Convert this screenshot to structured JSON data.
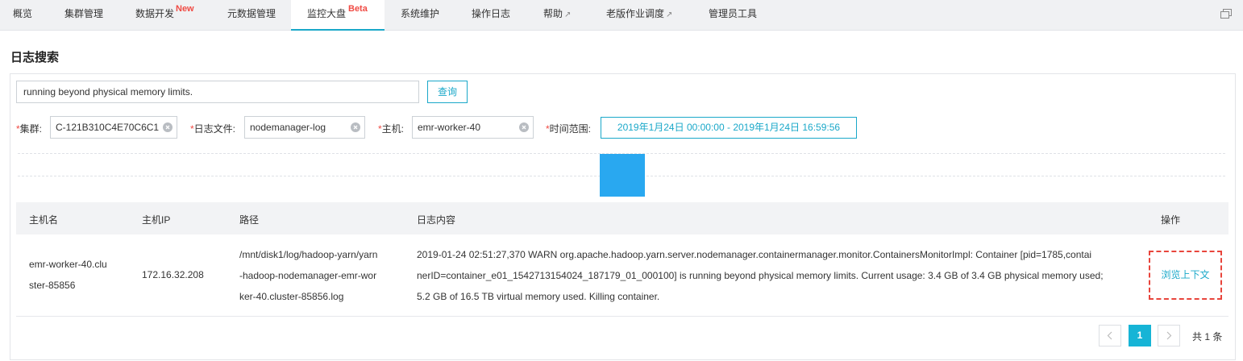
{
  "nav": {
    "tabs": [
      {
        "label": "概览"
      },
      {
        "label": "集群管理"
      },
      {
        "label": "数据开发",
        "badge": "New"
      },
      {
        "label": "元数据管理"
      },
      {
        "label": "监控大盘",
        "badge": "Beta",
        "active": true
      },
      {
        "label": "系统维护"
      },
      {
        "label": "操作日志"
      },
      {
        "label": "帮助",
        "external": true
      },
      {
        "label": "老版作业调度",
        "external": true
      },
      {
        "label": "管理员工具"
      }
    ]
  },
  "page": {
    "title": "日志搜索"
  },
  "search": {
    "value": "running beyond physical memory limits.",
    "button": "查询"
  },
  "filters": {
    "cluster": {
      "label": "集群:",
      "value": "C-121B310C4E70C6C1"
    },
    "logfile": {
      "label": "日志文件:",
      "value": "nodemanager-log"
    },
    "host": {
      "label": "主机:",
      "value": "emr-worker-40"
    },
    "time": {
      "label": "时间范围:",
      "value": "2019年1月24日 00:00:00 - 2019年1月24日 16:59:56"
    }
  },
  "table": {
    "columns": [
      "主机名",
      "主机IP",
      "路径",
      "日志内容",
      "操作"
    ],
    "rows": [
      {
        "hostname_lines": [
          "emr-worker-40.clu",
          "ster-85856"
        ],
        "ip": "172.16.32.208",
        "path_lines": [
          "/mnt/disk1/log/hadoop-yarn/yarn",
          "-hadoop-nodemanager-emr-wor",
          "ker-40.cluster-85856.log"
        ],
        "content_lines": [
          "2019-01-24 02:51:27,370 WARN org.apache.hadoop.yarn.server.nodemanager.containermanager.monitor.ContainersMonitorImpl: Container [pid=1785,contai",
          "nerID=container_e01_1542713154024_187179_01_000100] is running beyond physical memory limits. Current usage: 3.4 GB of 3.4 GB physical memory used;",
          "5.2 GB of 16.5 TB virtual memory used. Killing container."
        ],
        "action": "浏览上下文"
      }
    ]
  },
  "pagination": {
    "current": "1",
    "total": "共 1 条"
  },
  "colors": {
    "accent": "#1aa8c9",
    "badge": "#f04a43",
    "block": "#29a8f0",
    "highlight_border": "#e8453c"
  }
}
